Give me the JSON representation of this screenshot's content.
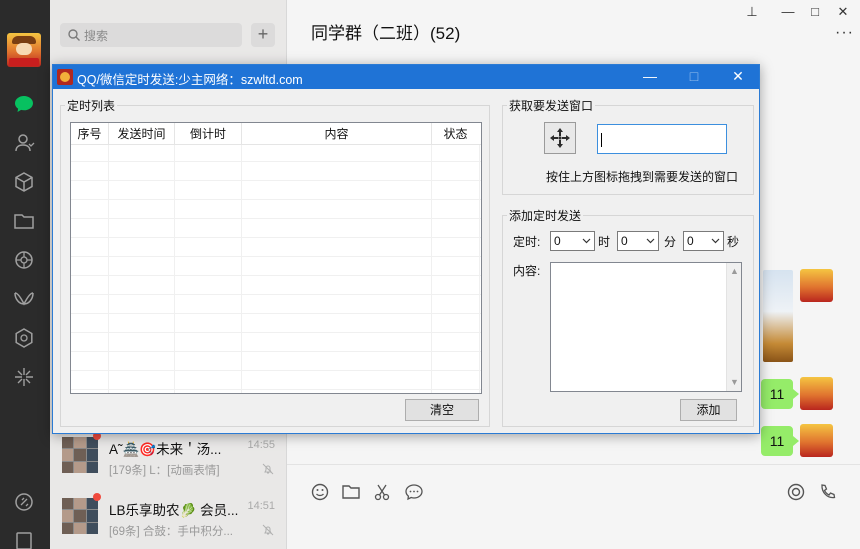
{
  "wechat": {
    "search_placeholder": "搜索",
    "add_label": "+",
    "chat_title": "同学群（二班）(52)",
    "more_label": "···",
    "window_controls": {
      "pin": "⊥",
      "minimize": "—",
      "maximize": "□",
      "close": "✕"
    },
    "conversations": [
      {
        "name": "A˜🏯🎯未来＇汤...",
        "time": "14:55",
        "preview": "[179条] L：[动画表情]"
      },
      {
        "name": "LB乐享助农🥬 会员...",
        "time": "14:51",
        "preview": "[69条] 合鼓：手中积分..."
      }
    ],
    "messages": [
      {
        "text": "11"
      },
      {
        "text": "11"
      }
    ]
  },
  "dialog": {
    "title": "QQ/微信定时发送:少主网络：szwltd.com",
    "controls": {
      "minimize": "—",
      "maximize": "□",
      "close": "✕"
    },
    "list_group": "定时列表",
    "columns": [
      "序号",
      "发送时间",
      "倒计时",
      "内容",
      "状态"
    ],
    "clear_button": "清空",
    "window_group": "获取要发送窗口",
    "handle_value": "",
    "drag_hint": "按住上方图标拖拽到需要发送的窗口",
    "add_group": "添加定时发送",
    "time_label": "定时:",
    "hour": {
      "value": "0",
      "unit": "时"
    },
    "minute": {
      "value": "0",
      "unit": "分"
    },
    "second": {
      "value": "0",
      "unit": "秒"
    },
    "content_label": "内容:",
    "add_button": "添加"
  }
}
